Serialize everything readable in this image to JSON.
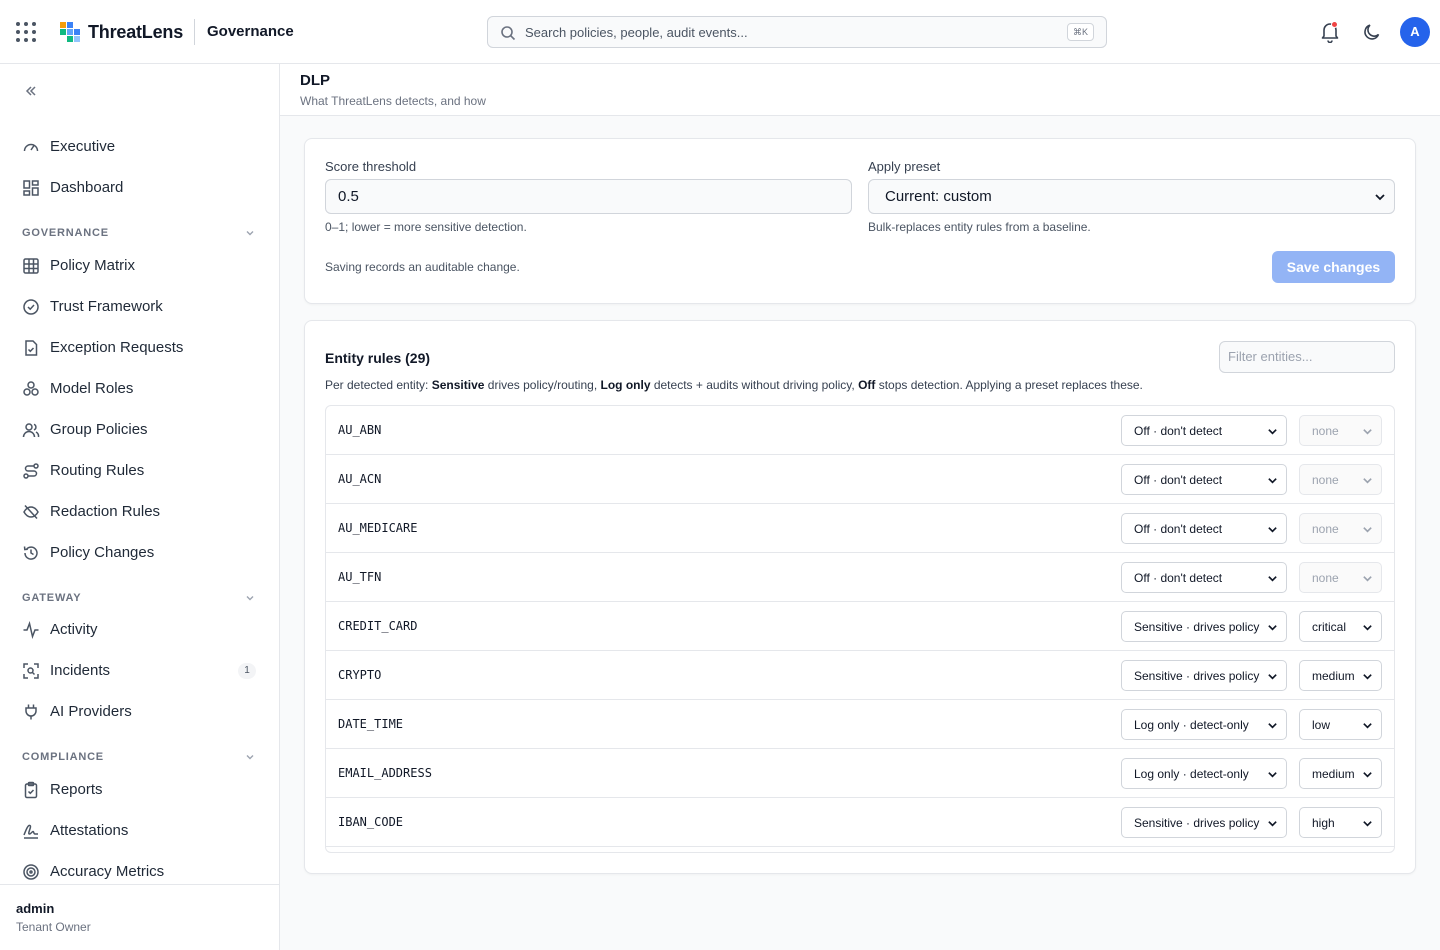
{
  "app": {
    "brand": "ThreatLens",
    "section": "Governance",
    "search_placeholder": "Search policies, people, audit events...",
    "search_shortcut": "⌘K",
    "avatar_initial": "A",
    "accent_color": "#2563eb",
    "notification_dot_color": "#ef4444"
  },
  "sidebar": {
    "top_items": [
      {
        "label": "Executive",
        "icon": "gauge-icon"
      },
      {
        "label": "Dashboard",
        "icon": "dashboard-icon"
      }
    ],
    "groups": [
      {
        "label": "GOVERNANCE",
        "items": [
          {
            "label": "Policy Matrix",
            "icon": "table-grid-icon"
          },
          {
            "label": "Trust Framework",
            "icon": "check-circle-icon"
          },
          {
            "label": "Exception Requests",
            "icon": "file-check-icon"
          },
          {
            "label": "Model Roles",
            "icon": "roles-icon"
          },
          {
            "label": "Group Policies",
            "icon": "users-icon"
          },
          {
            "label": "Routing Rules",
            "icon": "route-icon"
          },
          {
            "label": "Redaction Rules",
            "icon": "eye-off-icon"
          },
          {
            "label": "Policy Changes",
            "icon": "history-icon"
          }
        ]
      },
      {
        "label": "GATEWAY",
        "items": [
          {
            "label": "Activity",
            "icon": "activity-icon"
          },
          {
            "label": "Incidents",
            "icon": "incident-scan-icon",
            "badge": "1"
          },
          {
            "label": "AI Providers",
            "icon": "plug-icon"
          }
        ]
      },
      {
        "label": "COMPLIANCE",
        "items": [
          {
            "label": "Reports",
            "icon": "clipboard-check-icon"
          },
          {
            "label": "Attestations",
            "icon": "signature-icon"
          },
          {
            "label": "Accuracy Metrics",
            "icon": "target-icon"
          }
        ]
      }
    ],
    "user": {
      "name": "admin",
      "role": "Tenant Owner"
    }
  },
  "page": {
    "title": "DLP",
    "subtitle": "What ThreatLens detects, and how"
  },
  "settings": {
    "threshold_label": "Score threshold",
    "threshold_value": "0.5",
    "threshold_help": "0–1; lower = more sensitive detection.",
    "preset_label": "Apply preset",
    "preset_value": "Current: custom",
    "preset_help": "Bulk-replaces entity rules from a baseline.",
    "audit_note": "Saving records an auditable change.",
    "save_label": "Save changes"
  },
  "entity_rules": {
    "title": "Entity rules (29)",
    "filter_placeholder": "Filter entities...",
    "desc": {
      "p1": "Per detected entity: ",
      "b1": "Sensitive",
      "p2": " drives policy/routing, ",
      "b2": "Log only",
      "p3": " detects + audits without driving policy, ",
      "b3": "Off",
      "p4": " stops detection. Applying a preset replaces these."
    },
    "rows": [
      {
        "entity": "AU_ABN",
        "mode": "Off · don't detect",
        "severity": "none",
        "severity_disabled": true
      },
      {
        "entity": "AU_ACN",
        "mode": "Off · don't detect",
        "severity": "none",
        "severity_disabled": true
      },
      {
        "entity": "AU_MEDICARE",
        "mode": "Off · don't detect",
        "severity": "none",
        "severity_disabled": true
      },
      {
        "entity": "AU_TFN",
        "mode": "Off · don't detect",
        "severity": "none",
        "severity_disabled": true
      },
      {
        "entity": "CREDIT_CARD",
        "mode": "Sensitive · drives policy",
        "severity": "critical",
        "severity_disabled": false
      },
      {
        "entity": "CRYPTO",
        "mode": "Sensitive · drives policy",
        "severity": "medium",
        "severity_disabled": false
      },
      {
        "entity": "DATE_TIME",
        "mode": "Log only · detect-only",
        "severity": "low",
        "severity_disabled": false
      },
      {
        "entity": "EMAIL_ADDRESS",
        "mode": "Log only · detect-only",
        "severity": "medium",
        "severity_disabled": false
      },
      {
        "entity": "IBAN_CODE",
        "mode": "Sensitive · drives policy",
        "severity": "high",
        "severity_disabled": false
      }
    ]
  }
}
